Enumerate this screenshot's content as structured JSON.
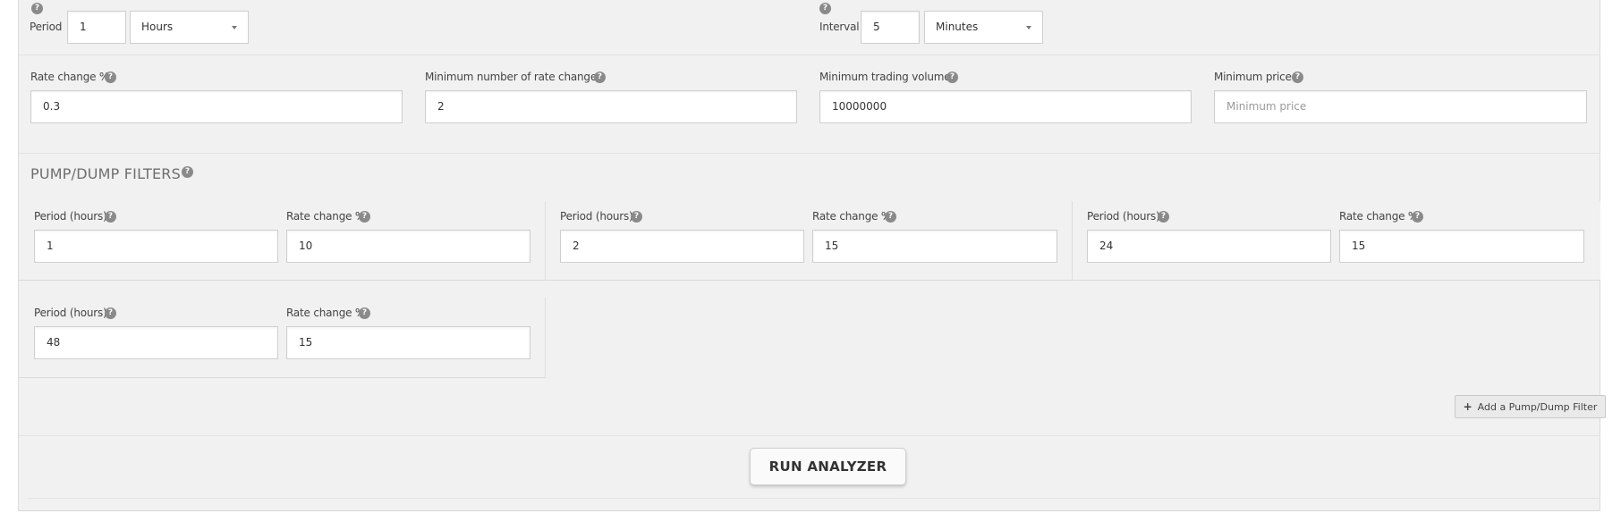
{
  "time_period": {
    "label": "Period",
    "value": "1",
    "unit": "Hours"
  },
  "time_interval": {
    "label": "Interval",
    "value": "5",
    "unit": "Minutes"
  },
  "criteria": {
    "rate_change": {
      "label": "Rate change %",
      "value": "0.3"
    },
    "min_rate_changes": {
      "label": "Minimum number of rate changes",
      "value": "2"
    },
    "min_volume": {
      "label": "Minimum trading volume",
      "value": "10000000"
    },
    "min_price": {
      "label": "Minimum price",
      "value": "",
      "placeholder": "Minimum price"
    }
  },
  "pump_dump": {
    "title": "PUMP/DUMP FILTERS",
    "period_label": "Period (hours)",
    "rate_label": "Rate change %",
    "filters": [
      {
        "period": "1",
        "rate": "10"
      },
      {
        "period": "2",
        "rate": "15"
      },
      {
        "period": "24",
        "rate": "15"
      },
      {
        "period": "48",
        "rate": "15"
      }
    ],
    "add_label": "Add a Pump/Dump Filter"
  },
  "run_label": "RUN ANALYZER",
  "icons": {
    "help": "question-circle-icon",
    "dropdown": "caret-down-icon",
    "add": "plus-icon"
  }
}
